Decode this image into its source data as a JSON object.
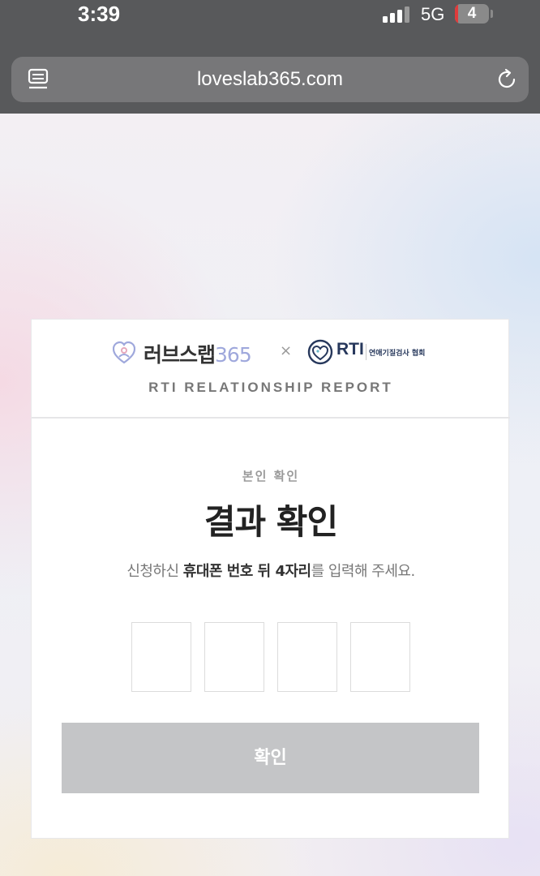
{
  "status_bar": {
    "time": "3:39",
    "network": "5G",
    "battery": "4",
    "signal_bars": 3
  },
  "browser": {
    "url": "loveslab365.com",
    "reader_icon": "reader-icon",
    "reload_icon": "reload-icon"
  },
  "card": {
    "brand_name": "러브스랩",
    "brand_number": "365",
    "times_symbol": "×",
    "partner_name": "RTI",
    "partner_org": "연애기질검사 협회",
    "report_title": "RTI RELATIONSHIP REPORT",
    "eyebrow": "본인 확인",
    "title": "결과 확인",
    "instruction_prefix": "신청하신 ",
    "instruction_bold": "휴대폰 번호 뒤 4자리",
    "instruction_suffix": "를 입력해 주세요.",
    "digit_values": [
      "",
      "",
      "",
      ""
    ],
    "confirm_label": "확인"
  },
  "colors": {
    "browser_chrome": "#58595b",
    "address_bar": "#777779",
    "button_disabled": "#c4c5c7",
    "brand_accent": "#9fa8dc",
    "rti_navy": "#27385c"
  }
}
